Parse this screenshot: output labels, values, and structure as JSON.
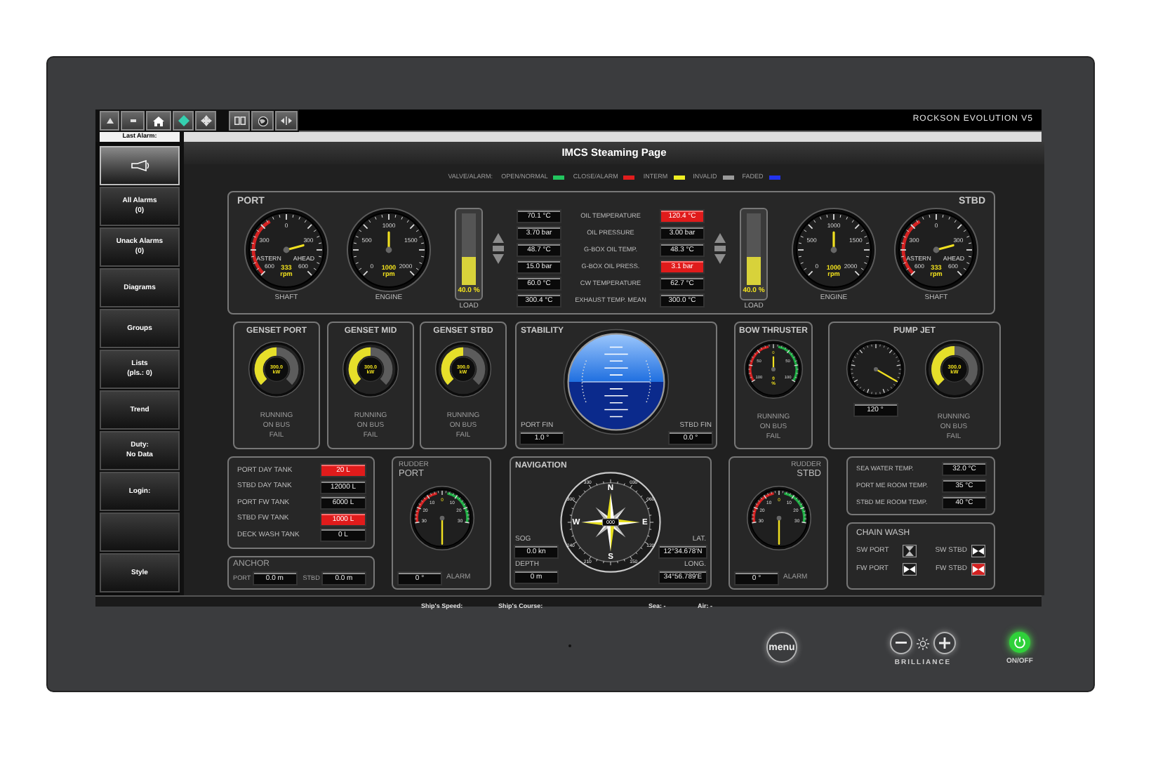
{
  "toolbar": {
    "brand": "ROCKSON EVOLUTION V5"
  },
  "last_alarm": {
    "label": "Last Alarm:"
  },
  "sidebar": [
    {
      "kind": "horn"
    },
    {
      "kind": "text",
      "lines": [
        "All Alarms",
        "(0)"
      ]
    },
    {
      "kind": "text",
      "lines": [
        "Unack Alarms",
        "(0)"
      ]
    },
    {
      "kind": "text",
      "lines": [
        "Diagrams"
      ]
    },
    {
      "kind": "text",
      "lines": [
        "Groups"
      ]
    },
    {
      "kind": "text",
      "lines": [
        "Lists",
        "(pls.: 0)"
      ]
    },
    {
      "kind": "text",
      "lines": [
        "Trend"
      ]
    },
    {
      "kind": "text",
      "lines": [
        "Duty:",
        "No Data"
      ]
    },
    {
      "kind": "text",
      "lines": [
        "Login:"
      ]
    },
    {
      "kind": "blank"
    },
    {
      "kind": "text",
      "lines": [
        "Style"
      ]
    }
  ],
  "page_title": "IMCS Steaming Page",
  "legend": {
    "label": "VALVE/ALARM:",
    "items": [
      {
        "label": "OPEN/NORMAL",
        "color": "#22c55e"
      },
      {
        "label": "CLOSE/ALARM",
        "color": "#e11d1d"
      },
      {
        "label": "INTERM",
        "color": "#eeee22"
      },
      {
        "label": "INVALID",
        "color": "#9a9a9a"
      },
      {
        "label": "FADED",
        "color": "#2233ee"
      }
    ]
  },
  "propulsion": {
    "port": {
      "title": "PORT",
      "shaft": {
        "kind": "shaft",
        "caption": "SHAFT",
        "scale": [
          "600",
          "300",
          "0",
          "300",
          "600"
        ],
        "sides": [
          "ASTERN",
          "AHEAD"
        ],
        "readout": [
          "333",
          "rpm"
        ]
      },
      "engine": {
        "kind": "engine",
        "caption": "ENGINE",
        "scale": [
          "0",
          "500",
          "1000",
          "1500",
          "2000"
        ],
        "readout": [
          "1000",
          "rpm"
        ]
      },
      "load": {
        "caption": "LOAD",
        "level": 0.4,
        "readout": "40.0 %"
      }
    },
    "stbd": {
      "title": "STBD",
      "shaft": {
        "kind": "shaft",
        "caption": "SHAFT",
        "scale": [
          "600",
          "300",
          "0",
          "300",
          "600"
        ],
        "sides": [
          "ASTERN",
          "AHEAD"
        ],
        "readout": [
          "333",
          "rpm"
        ]
      },
      "engine": {
        "kind": "engine",
        "caption": "ENGINE",
        "scale": [
          "0",
          "500",
          "1000",
          "1500",
          "2000"
        ],
        "readout": [
          "1000",
          "rpm"
        ]
      },
      "load": {
        "caption": "LOAD",
        "level": 0.4,
        "readout": "40.0 %"
      }
    },
    "readings": [
      {
        "label": "OIL TEMPERATURE",
        "port": {
          "value": "70.1 °C",
          "alarm": false
        },
        "stbd": {
          "value": "120.4 °C",
          "alarm": true
        }
      },
      {
        "label": "OIL PRESSURE",
        "port": {
          "value": "3.70 bar",
          "alarm": false
        },
        "stbd": {
          "value": "3.00 bar",
          "alarm": false
        }
      },
      {
        "label": "G-BOX OIL TEMP.",
        "port": {
          "value": "48.7 °C",
          "alarm": false
        },
        "stbd": {
          "value": "48.3 °C",
          "alarm": false
        }
      },
      {
        "label": "G-BOX OIL PRESS.",
        "port": {
          "value": "15.0 bar",
          "alarm": false
        },
        "stbd": {
          "value": "3.1 bar",
          "alarm": true
        }
      },
      {
        "label": "CW TEMPERATURE",
        "port": {
          "value": "60.0 °C",
          "alarm": false
        },
        "stbd": {
          "value": "62.7 °C",
          "alarm": false
        }
      },
      {
        "label": "EXHAUST TEMP. MEAN",
        "port": {
          "value": "300.4 °C",
          "alarm": false
        },
        "stbd": {
          "value": "300.0 °C",
          "alarm": false
        }
      }
    ]
  },
  "gensets": [
    {
      "title": "GENSET PORT",
      "gauge": {
        "kind": "power",
        "readout": [
          "300.0",
          "kW"
        ]
      },
      "status": [
        "RUNNING",
        "ON BUS",
        "FAIL"
      ]
    },
    {
      "title": "GENSET MID",
      "gauge": {
        "kind": "power",
        "readout": [
          "300.0",
          "kW"
        ]
      },
      "status": [
        "RUNNING",
        "ON BUS",
        "FAIL"
      ]
    },
    {
      "title": "GENSET STBD",
      "gauge": {
        "kind": "power",
        "readout": [
          "300.0",
          "kW"
        ]
      },
      "status": [
        "RUNNING",
        "ON BUS",
        "FAIL"
      ]
    }
  ],
  "stability": {
    "title": "STABILITY",
    "port_fin": {
      "label": "PORT FIN",
      "value": "1.0 °"
    },
    "stbd_fin": {
      "label": "STBD FIN",
      "value": "0.0 °"
    }
  },
  "bow_thruster": {
    "title": "BOW THRUSTER",
    "gauge": {
      "kind": "thruster",
      "scale": [
        "100",
        "50",
        "0",
        "50",
        "100"
      ],
      "readout": [
        "0",
        "%"
      ]
    },
    "status": [
      "RUNNING",
      "ON BUS",
      "FAIL"
    ]
  },
  "pump_jet": {
    "title": "PUMP JET",
    "angle_gauge": {
      "kind": "angle"
    },
    "angle_value": "120 °",
    "power_gauge": {
      "kind": "power",
      "readout": [
        "300.0",
        "kW"
      ]
    },
    "status": [
      "RUNNING",
      "ON BUS",
      "FAIL"
    ]
  },
  "tanks": [
    {
      "label": "PORT DAY TANK",
      "value": "20 L",
      "alarm": true
    },
    {
      "label": "STBD DAY TANK",
      "value": "12000 L",
      "alarm": false
    },
    {
      "label": "PORT FW TANK",
      "value": "6000 L",
      "alarm": false
    },
    {
      "label": "STBD FW TANK",
      "value": "1000 L",
      "alarm": true
    },
    {
      "label": "DECK WASH TANK",
      "value": "0 L",
      "alarm": false
    }
  ],
  "anchor": {
    "title": "ANCHOR",
    "port": {
      "label": "PORT",
      "value": "0.0 m"
    },
    "stbd": {
      "label": "STBD",
      "value": "0.0 m"
    }
  },
  "rudders": [
    {
      "right_aligned": false,
      "title": "RUDDER",
      "subtitle": "PORT",
      "gauge": {
        "kind": "rudder",
        "scale": [
          "30",
          "20",
          "10",
          "0",
          "10",
          "20",
          "30"
        ]
      },
      "value": "0 °",
      "alarm_label": "ALARM"
    },
    {
      "right_aligned": true,
      "title": "RUDDER",
      "subtitle": "STBD",
      "gauge": {
        "kind": "rudder",
        "scale": [
          "30",
          "20",
          "10",
          "0",
          "10",
          "20",
          "30"
        ]
      },
      "value": "0 °",
      "alarm_label": "ALARM"
    }
  ],
  "navigation": {
    "title": "NAVIGATION",
    "heading": "000",
    "cardinals": [
      "N",
      "E",
      "S",
      "W"
    ],
    "bearings": [
      "030",
      "060",
      "120",
      "150",
      "210",
      "240",
      "300",
      "330"
    ],
    "sog": {
      "label": "SOG",
      "value": "0.0 kn"
    },
    "depth": {
      "label": "DEPTH",
      "value": "0 m"
    },
    "lat": {
      "label": "LAT.",
      "value": "12°34.678'N"
    },
    "long": {
      "label": "LONG.",
      "value": "34°56.789'E"
    }
  },
  "temperatures": [
    {
      "label": "SEA WATER TEMP.",
      "value": "32.0 °C"
    },
    {
      "label": "PORT ME ROOM TEMP.",
      "value": "35 °C"
    },
    {
      "label": "STBD ME ROOM TEMP.",
      "value": "40 °C"
    }
  ],
  "chain_wash": {
    "title": "CHAIN WASH",
    "valves": [
      {
        "label": "SW PORT",
        "open": false,
        "alarm": false
      },
      {
        "label": "SW STBD",
        "open": true,
        "alarm": false
      },
      {
        "label": "FW PORT",
        "open": true,
        "alarm": false
      },
      {
        "label": "FW STBD",
        "open": true,
        "alarm": true
      }
    ]
  },
  "status_bar": [
    "Ship's Speed:",
    "Ship's Course:",
    "Sea: -",
    "Air: -"
  ],
  "bezel": {
    "menu": "menu",
    "brilliance": "BRILLIANCE",
    "power": {
      "label": "ON/OFF",
      "on": true
    }
  }
}
